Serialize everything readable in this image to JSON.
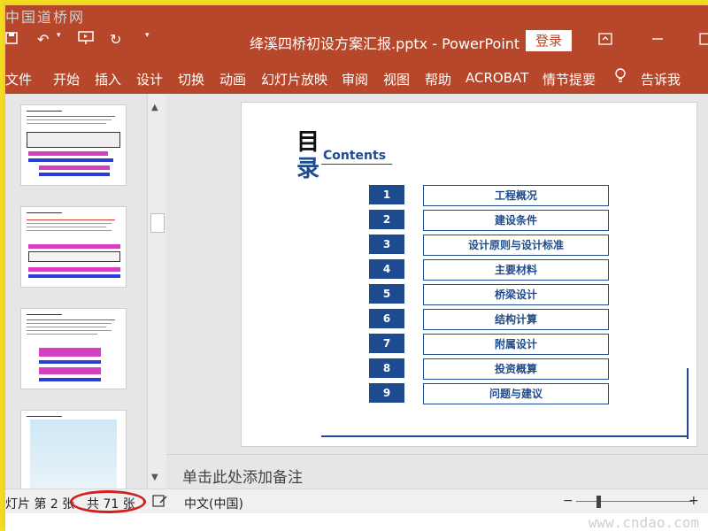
{
  "watermark": {
    "top_left": "中国道桥网",
    "bottom_right": "www.cndao.com"
  },
  "titlebar": {
    "title": "绛溪四桥初设方案汇报.pptx - PowerPoint",
    "login": "登录",
    "qa_undo": "↶",
    "qa_redo": "↻",
    "qa_more": "▾"
  },
  "ribbon": {
    "tabs": [
      "文件",
      "开始",
      "插入",
      "设计",
      "切换",
      "动画",
      "幻灯片放映",
      "审阅",
      "视图",
      "帮助",
      "ACROBAT",
      "情节提要",
      "告诉我"
    ]
  },
  "slide": {
    "heading_char1": "目",
    "heading_char2": "录",
    "heading_en": "Contents",
    "items": [
      {
        "num": "1",
        "label": "工程概况"
      },
      {
        "num": "2",
        "label": "建设条件"
      },
      {
        "num": "3",
        "label": "设计原则与设计标准"
      },
      {
        "num": "4",
        "label": "主要材料"
      },
      {
        "num": "5",
        "label": "桥梁设计"
      },
      {
        "num": "6",
        "label": "结构计算"
      },
      {
        "num": "7",
        "label": "附属设计"
      },
      {
        "num": "8",
        "label": "投资概算"
      },
      {
        "num": "9",
        "label": "问题与建议"
      }
    ]
  },
  "notes": {
    "placeholder": "单击此处添加备注"
  },
  "status": {
    "slide_pos": "灯片 第 2 张",
    "total": "共 71 张",
    "language": "中文(中国)",
    "zoom_minus": "−",
    "zoom_plus": "+"
  },
  "colors": {
    "ribbon": "#b7472a",
    "accent": "#1e4b8f",
    "highlight": "#d21f1f"
  }
}
